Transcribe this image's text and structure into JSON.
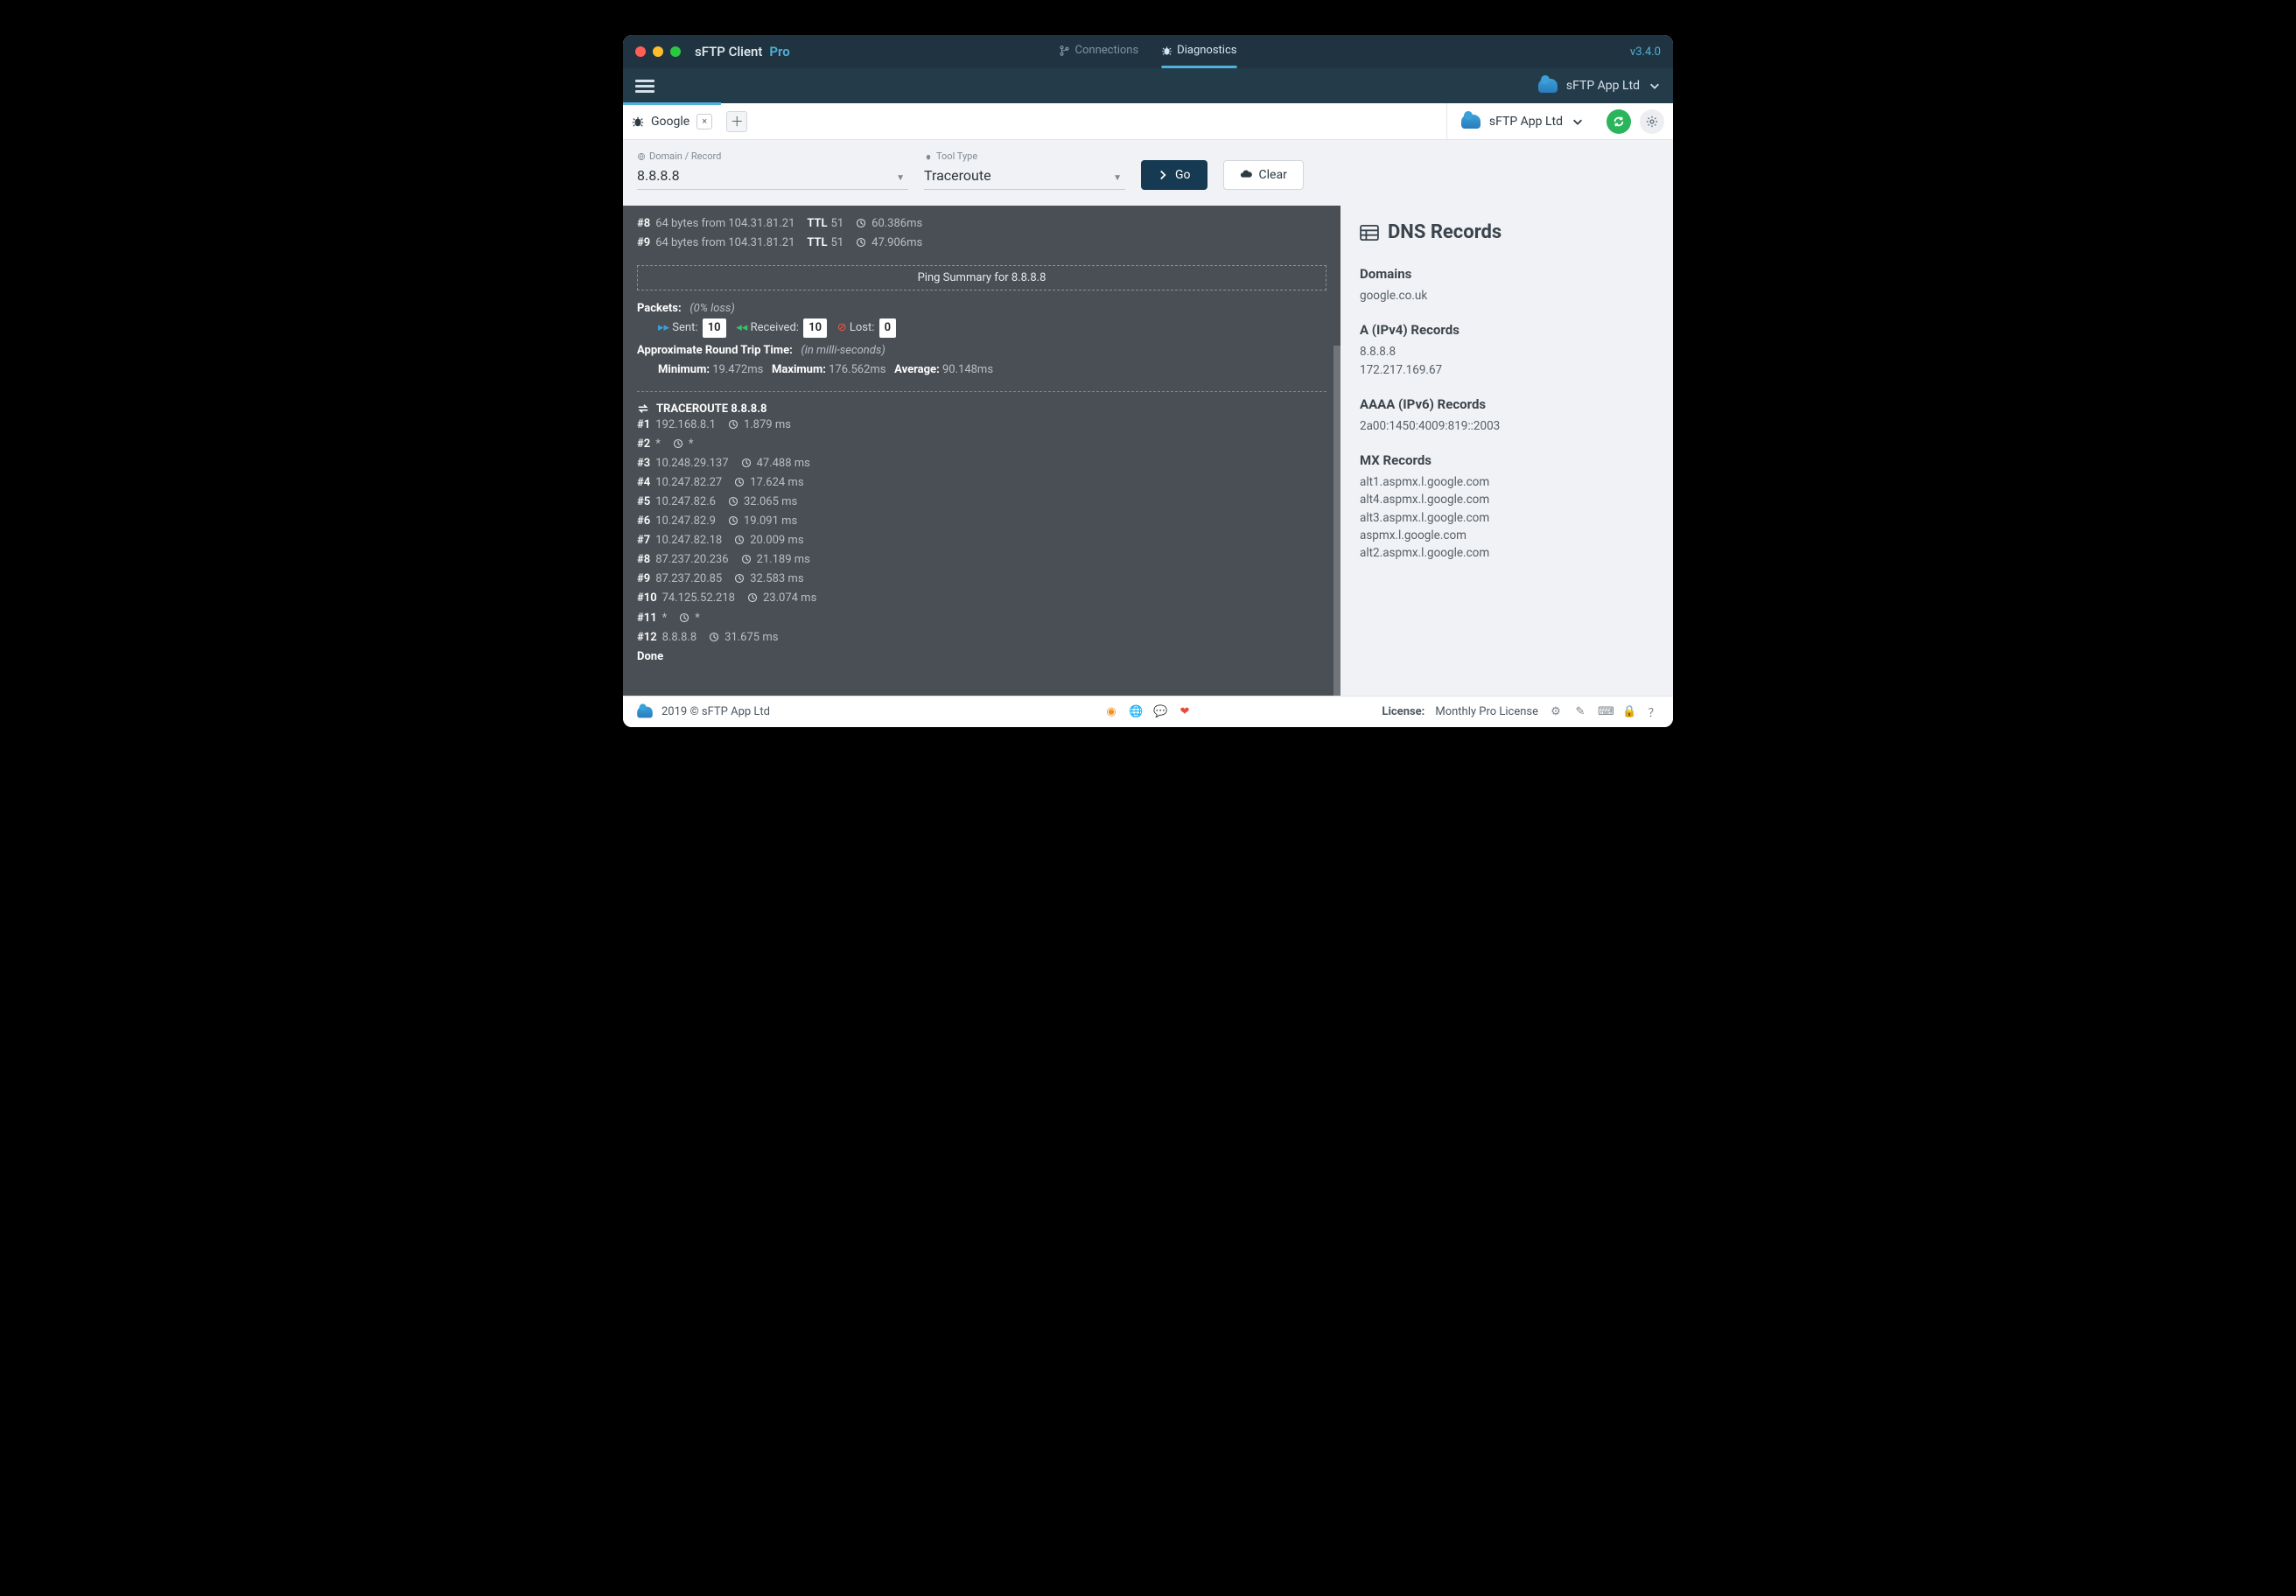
{
  "titlebar": {
    "app_name": "sFTP Client",
    "edition": "Pro",
    "tabs": [
      {
        "label": "Connections",
        "icon": "branch-icon"
      },
      {
        "label": "Diagnostics",
        "icon": "bug-icon",
        "active": true
      }
    ],
    "version": "v3.4.0"
  },
  "secondbar": {
    "account": "sFTP App Ltd"
  },
  "tabstrip": {
    "tab_icon": "bug-icon",
    "tab_label": "Google",
    "account": "sFTP App Ltd"
  },
  "query": {
    "domain_label": "Domain / Record",
    "domain_value": "8.8.8.8",
    "tool_label": "Tool Type",
    "tool_value": "Traceroute",
    "go": "Go",
    "clear": "Clear"
  },
  "ping_tail": [
    {
      "n": "#8",
      "text": "64 bytes from 104.31.81.21",
      "ttl": "51",
      "ms": "60.386ms"
    },
    {
      "n": "#9",
      "text": "64 bytes from 104.31.81.21",
      "ttl": "51",
      "ms": "47.906ms"
    }
  ],
  "ping_summary": {
    "title": "Ping Summary for 8.8.8.8",
    "packets_label": "Packets:",
    "packets_note": "(0% loss)",
    "sent_label": "Sent:",
    "sent": "10",
    "recv_label": "Received:",
    "recv": "10",
    "lost_label": "Lost:",
    "lost": "0",
    "rtt_label": "Approximate Round Trip Time:",
    "rtt_note": "(in milli-seconds)",
    "min_label": "Minimum:",
    "min": "19.472ms",
    "max_label": "Maximum:",
    "max": "176.562ms",
    "avg_label": "Average:",
    "avg": "90.148ms"
  },
  "traceroute": {
    "heading": "TRACEROUTE 8.8.8.8",
    "hops": [
      {
        "n": "#1",
        "ip": "192.168.8.1",
        "ms": "1.879 ms"
      },
      {
        "n": "#2",
        "ip": "*",
        "ms": "*",
        "timeout": true
      },
      {
        "n": "#3",
        "ip": "10.248.29.137",
        "ms": "47.488 ms"
      },
      {
        "n": "#4",
        "ip": "10.247.82.27",
        "ms": "17.624 ms"
      },
      {
        "n": "#5",
        "ip": "10.247.82.6",
        "ms": "32.065 ms"
      },
      {
        "n": "#6",
        "ip": "10.247.82.9",
        "ms": "19.091 ms"
      },
      {
        "n": "#7",
        "ip": "10.247.82.18",
        "ms": "20.009 ms"
      },
      {
        "n": "#8",
        "ip": "87.237.20.236",
        "ms": "21.189 ms"
      },
      {
        "n": "#9",
        "ip": "87.237.20.85",
        "ms": "32.583 ms"
      },
      {
        "n": "#10",
        "ip": "74.125.52.218",
        "ms": "23.074 ms"
      },
      {
        "n": "#11",
        "ip": "*",
        "ms": "*",
        "timeout": true
      },
      {
        "n": "#12",
        "ip": "8.8.8.8",
        "ms": "31.675 ms"
      }
    ],
    "done": "Done"
  },
  "dns": {
    "heading": "DNS Records",
    "sections": [
      {
        "title": "Domains",
        "records": [
          "google.co.uk"
        ]
      },
      {
        "title": "A (IPv4) Records",
        "records": [
          "8.8.8.8",
          "172.217.169.67"
        ]
      },
      {
        "title": "AAAA (IPv6) Records",
        "records": [
          "2a00:1450:4009:819::2003"
        ]
      },
      {
        "title": "MX Records",
        "records": [
          "alt1.aspmx.l.google.com",
          "alt4.aspmx.l.google.com",
          "alt3.aspmx.l.google.com",
          "aspmx.l.google.com",
          "alt2.aspmx.l.google.com"
        ]
      }
    ]
  },
  "footer": {
    "copyright": "2019 © sFTP App Ltd",
    "license_label": "License:",
    "license_value": "Monthly Pro License"
  }
}
